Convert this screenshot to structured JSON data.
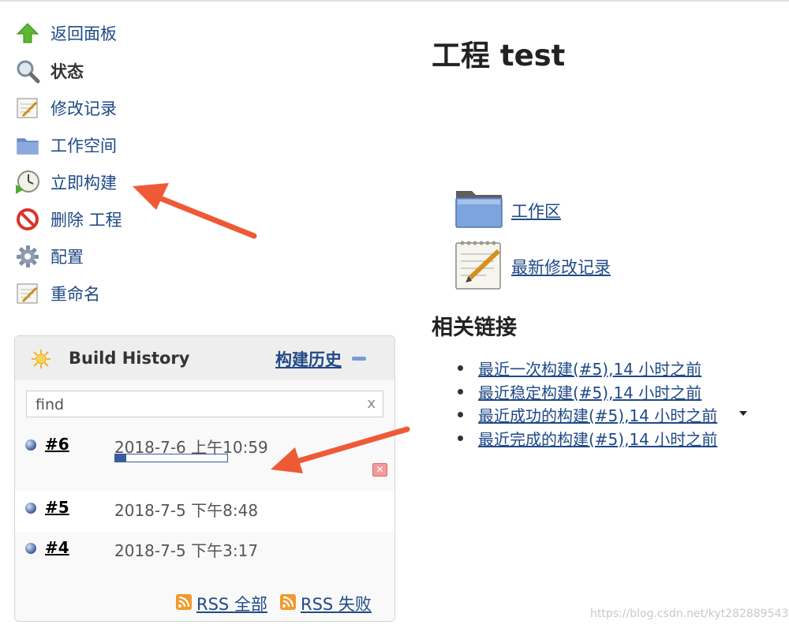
{
  "sidepanel": {
    "tasks": [
      {
        "label": "返回面板",
        "icon": "up-arrow-icon"
      },
      {
        "label": "状态",
        "icon": "search-icon"
      },
      {
        "label": "修改记录",
        "icon": "notepad-icon"
      },
      {
        "label": "工作空间",
        "icon": "folder-icon"
      },
      {
        "label": "立即构建",
        "icon": "build-clock-icon"
      },
      {
        "label": "删除 工程",
        "icon": "no-entry-icon"
      },
      {
        "label": "配置",
        "icon": "gear-icon"
      },
      {
        "label": "重命名",
        "icon": "notepad-icon"
      }
    ]
  },
  "build_history": {
    "title": "Build History",
    "trend_link": "构建历史",
    "search_value": "find",
    "clear_label": "x",
    "builds": [
      {
        "number": "#6",
        "date": "2018-7-6 上午10:59",
        "progress_percent": 10,
        "status": "running"
      },
      {
        "number": "#5",
        "date": "2018-7-5 下午8:48",
        "status": "success"
      },
      {
        "number": "#4",
        "date": "2018-7-5 下午3:17",
        "status": "success"
      }
    ],
    "rss_all": "RSS 全部",
    "rss_failed": "RSS 失败"
  },
  "main": {
    "title": "工程 test",
    "workspace_link": "工作区",
    "changes_link": "最新修改记录",
    "related_title": "相关链接",
    "permalinks": [
      "最近一次构建(#5),14 小时之前",
      "最近稳定构建(#5),14 小时之前",
      "最近成功的构建(#5),14 小时之前",
      "最近完成的构建(#5),14 小时之前"
    ]
  },
  "watermark": "https://blog.csdn.net/kyt282889543",
  "colors": {
    "link": "#204a87",
    "annotation_arrow": "#ee5a36",
    "progress": "#3a5c9c"
  }
}
